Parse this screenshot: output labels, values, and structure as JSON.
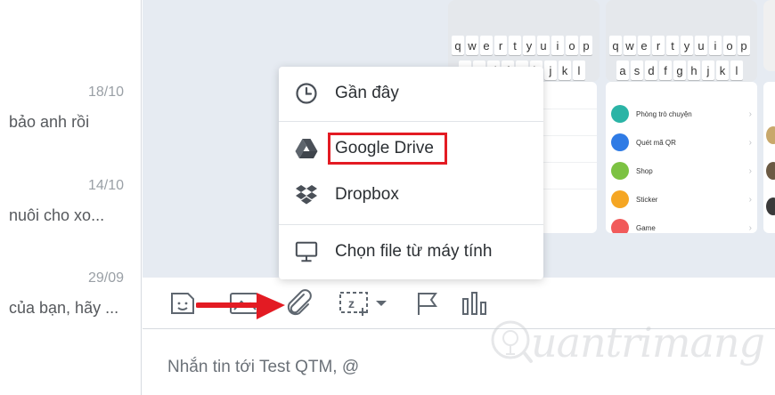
{
  "conversations": [
    {
      "date": "18/10",
      "preview": "bảo anh rồi"
    },
    {
      "date": "14/10",
      "preview": "nuôi cho xo..."
    },
    {
      "date": "29/09",
      "preview": "của bạn, hãy ..."
    }
  ],
  "keyboard": {
    "row1": [
      "q",
      "w",
      "e",
      "r",
      "t",
      "y",
      "u",
      "i",
      "o",
      "p"
    ],
    "row2": [
      "a",
      "s",
      "d",
      "f",
      "g",
      "h",
      "j",
      "k",
      "l"
    ]
  },
  "phone_menu": [
    {
      "label": "Phòng trò chuyện",
      "color": "#2bb4a6"
    },
    {
      "label": "Quét mã QR",
      "color": "#2f7be5"
    },
    {
      "label": "Shop",
      "color": "#7cc242"
    },
    {
      "label": "Sticker",
      "color": "#f5a623"
    },
    {
      "label": "Game",
      "color": "#f15a5a"
    }
  ],
  "attach_menu": {
    "recent_label": "Gần đây",
    "google_drive_label": "Google Drive",
    "dropbox_label": "Dropbox",
    "local_file_label": "Chọn file từ máy tính"
  },
  "composer": {
    "placeholder": "Nhắn tin tới Test QTM, @"
  },
  "watermark": {
    "text": "uantrimang"
  },
  "colors": {
    "highlight": "#e31b23",
    "arrow": "#e31b23",
    "chat_background": "#e6ebf2"
  }
}
